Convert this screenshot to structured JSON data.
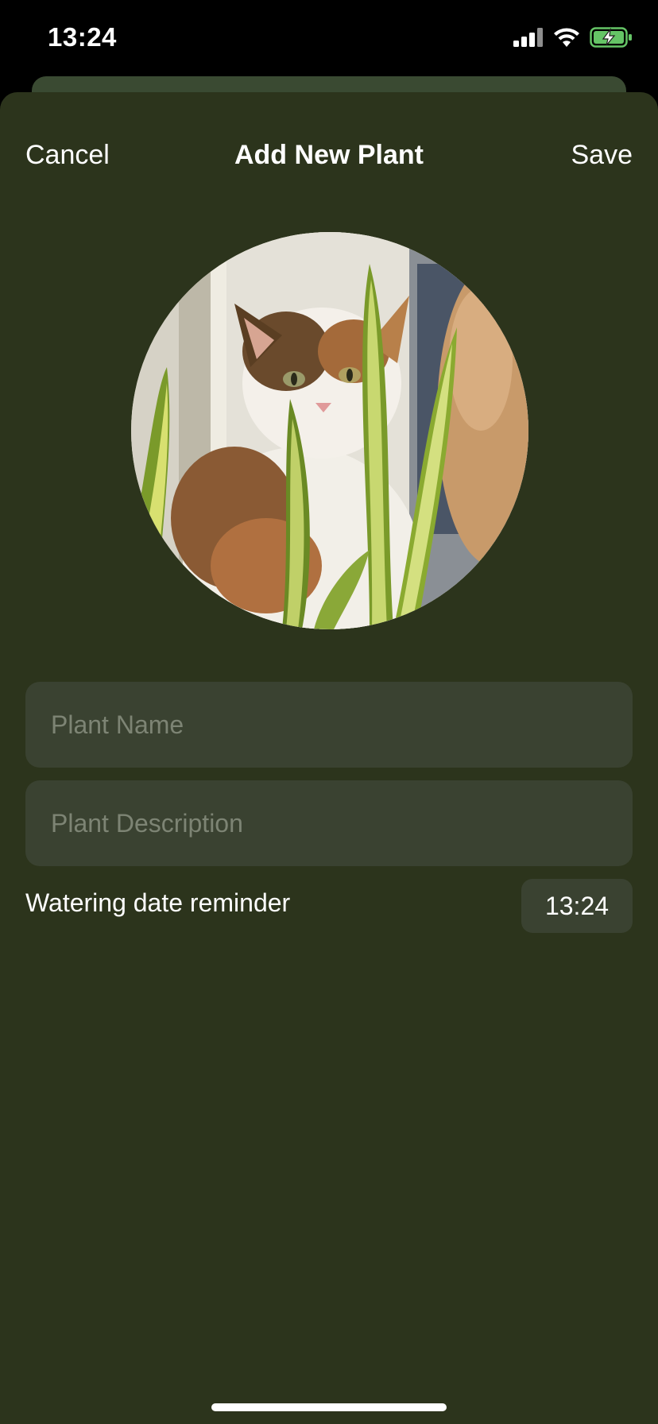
{
  "status_bar": {
    "time": "13:24",
    "icons": [
      "cellular-signal-icon",
      "wifi-icon",
      "battery-charging-icon"
    ],
    "battery_color": "#65c466"
  },
  "nav": {
    "cancel_label": "Cancel",
    "title": "Add New Plant",
    "save_label": "Save"
  },
  "photo": {
    "subject": "calico cat behind snake plant leaves"
  },
  "form": {
    "plant_name_placeholder": "Plant Name",
    "plant_name_value": "",
    "plant_description_placeholder": "Plant Description",
    "plant_description_value": "",
    "reminder_label": "Watering date reminder",
    "reminder_time": "13:24"
  },
  "colors": {
    "sheet_background": "#2c341c",
    "field_background": "#3a4231",
    "placeholder_text": "#7d8474",
    "text": "#ffffff"
  }
}
